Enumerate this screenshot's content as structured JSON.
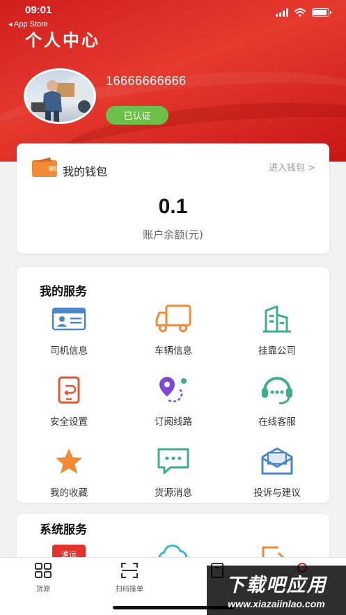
{
  "status_bar": {
    "time": "09:01",
    "back_label": "◂ App Store",
    "battery_level": 0.9
  },
  "header": {
    "title": "个人中心",
    "phone": "16666666666",
    "verified_badge": "已认证"
  },
  "wallet": {
    "title": "我的钱包",
    "enter_link": "进入钱包 >",
    "balance": "0.1",
    "balance_label": "账户余额(元)"
  },
  "services": {
    "title": "我的服务",
    "items": [
      {
        "label": "司机信息",
        "icon": "driver-id-icon"
      },
      {
        "label": "车辆信息",
        "icon": "truck-icon"
      },
      {
        "label": "挂靠公司",
        "icon": "building-icon"
      },
      {
        "label": "安全设置",
        "icon": "phone-security-icon"
      },
      {
        "label": "订阅线路",
        "icon": "route-pin-icon"
      },
      {
        "label": "在线客服",
        "icon": "headset-icon"
      },
      {
        "label": "我的收藏",
        "icon": "star-icon"
      },
      {
        "label": "货源消息",
        "icon": "message-icon"
      },
      {
        "label": "投诉与建议",
        "icon": "mail-icon"
      }
    ]
  },
  "system_services": {
    "title": "系统服务",
    "partial_logo_text": "速运"
  },
  "tabbar": {
    "tabs": [
      {
        "label": "货源"
      },
      {
        "label": "扫码接单"
      }
    ]
  },
  "watermark": {
    "line1": "下载吧应用",
    "line2": "www.xiazaiinlao.com"
  },
  "colors": {
    "header_red": "#d9261f",
    "badge_green": "#6cc04a",
    "blue": "#4a86c8",
    "orange": "#f08a34",
    "green": "#3fae8a",
    "purple": "#7b4ad0"
  }
}
